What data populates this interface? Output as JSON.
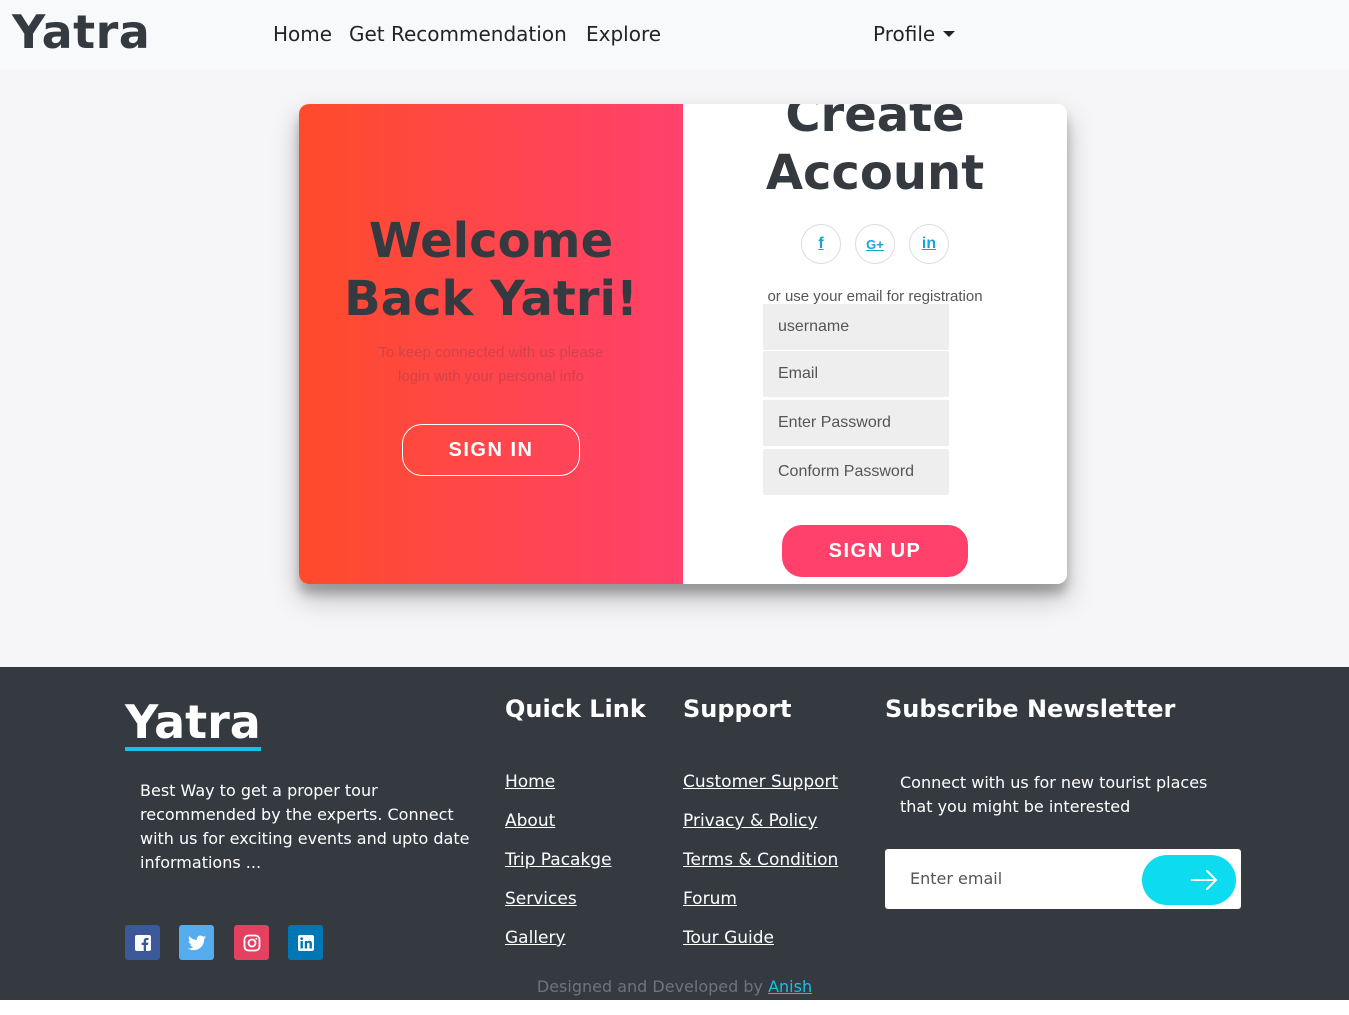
{
  "navbar": {
    "brand": "Yatra",
    "links": [
      "Home",
      "Get Recommendation",
      "Explore"
    ],
    "profile": "Profile"
  },
  "overlay": {
    "title_line1": "Welcome",
    "title_line2": "Back Yatri!",
    "subtitle": "To keep connected with us please login with your personal info",
    "signin_label": "SIGN IN"
  },
  "form": {
    "title_line1": "Create",
    "title_line2": "Account",
    "social": [
      "f",
      "G+",
      "in"
    ],
    "reg_text": "or use your email for registration",
    "fields": [
      "username",
      "Email",
      "Enter Password",
      "Conform Password"
    ],
    "signup_label": "SIGN UP"
  },
  "footer": {
    "brand": "Yatra",
    "description": "Best Way to get a proper tour recommended by the experts. Connect with us for exciting events and upto date informations ...",
    "quick_link_title": "Quick Link",
    "quick_links": [
      "Home",
      "About",
      "Trip Pacakge",
      "Services",
      "Gallery"
    ],
    "support_title": "Support",
    "support_links": [
      "Customer Support",
      "Privacy & Policy",
      "Terms & Condition",
      "Forum",
      "Tour Guide"
    ],
    "newsletter_title": "Subscribe Newsletter",
    "newsletter_text": "Connect with us for new tourist places that you might be interested",
    "email_placeholder": "Enter email",
    "credit_text": "Designed and Developed by ",
    "credit_name": "Anish"
  },
  "colors": {
    "accent": "#ff416c",
    "gradient_start": "#ff4b2b",
    "footer_bg": "#343a40",
    "newsletter_button": "#0ddbf0"
  }
}
